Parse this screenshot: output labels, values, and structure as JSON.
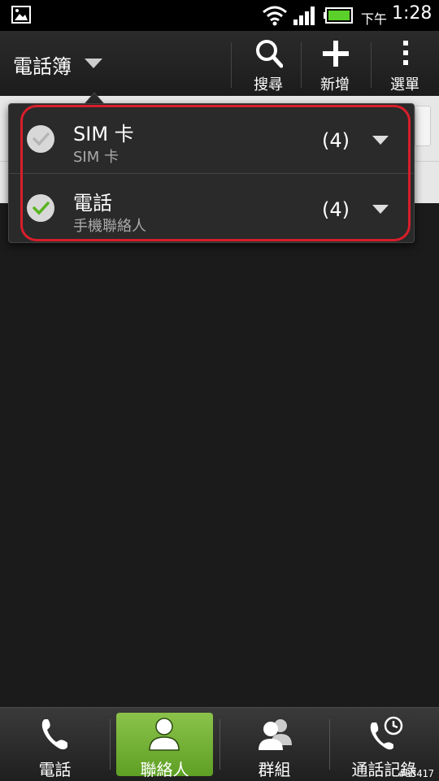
{
  "statusbar": {
    "ampm": "下午",
    "time": "1:28"
  },
  "actionbar": {
    "title": "電話簿",
    "buttons": [
      {
        "label": "搜尋",
        "icon": "search-icon"
      },
      {
        "label": "新增",
        "icon": "plus-icon"
      },
      {
        "label": "選單",
        "icon": "overflow-menu-icon"
      }
    ]
  },
  "popup": {
    "accounts": [
      {
        "name": "SIM 卡",
        "subtitle": "SIM 卡",
        "count": "(4)",
        "checked": false
      },
      {
        "name": "電話",
        "subtitle": "手機聯絡人",
        "count": "(4)",
        "checked": true
      }
    ]
  },
  "tabs": [
    {
      "label": "電話",
      "icon": "phone-icon",
      "active": false
    },
    {
      "label": "聯絡人",
      "icon": "person-icon",
      "active": true
    },
    {
      "label": "群組",
      "icon": "group-icon",
      "active": false
    },
    {
      "label": "通話記錄",
      "icon": "call-history-icon",
      "active": false
    }
  ],
  "watermark": "#83417",
  "colors": {
    "accent_green": "#8bc34a",
    "highlight_red": "#d81e2b"
  }
}
